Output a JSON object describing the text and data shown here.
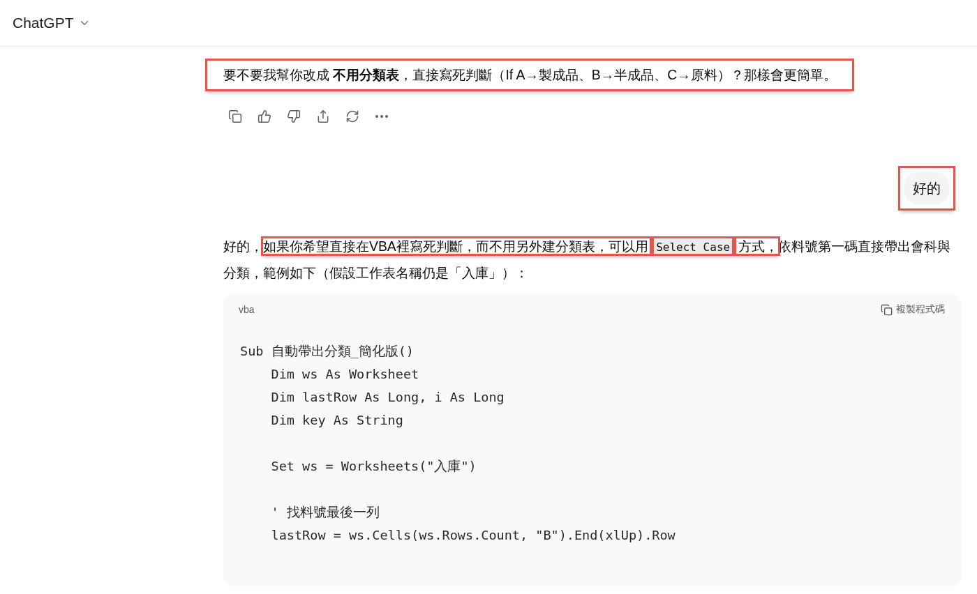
{
  "header": {
    "title": "ChatGPT"
  },
  "messages": [
    {
      "kind": "assistant",
      "highlighted": true,
      "text": "要不要我幫你改成 **不用分類表**，直接寫死判斷（If A→製成品、B→半成品、C→原料）？那樣會更簡單。"
    },
    {
      "kind": "user",
      "highlighted": true,
      "text": "好的"
    },
    {
      "kind": "assistant_code",
      "segments": [
        {
          "kind": "text",
          "highlighted": false,
          "text": "好的，"
        },
        {
          "kind": "text",
          "highlighted": true,
          "text": "如果你希望直接在VBA裡寫死判斷，而不用另外建分類表，可以用 "
        },
        {
          "kind": "code",
          "highlighted": true,
          "text": "Select Case"
        },
        {
          "kind": "text",
          "highlighted": true,
          "text": " 方式，"
        },
        {
          "kind": "text",
          "highlighted": false,
          "text": "依料號第一碼直接帶出會科與分類，範例如下（假設工作表名稱仍是「入庫」）："
        }
      ],
      "code_block": {
        "language": "vba",
        "copy_label": "複製程式碼",
        "code": "Sub 自動帶出分類_簡化版()\n    Dim ws As Worksheet\n    Dim lastRow As Long, i As Long\n    Dim key As String\n\n    Set ws = Worksheets(\"入庫\")\n\n    ' 找料號最後一列\n    lastRow = ws.Cells(ws.Rows.Count, \"B\").End(xlUp).Row"
      }
    }
  ]
}
